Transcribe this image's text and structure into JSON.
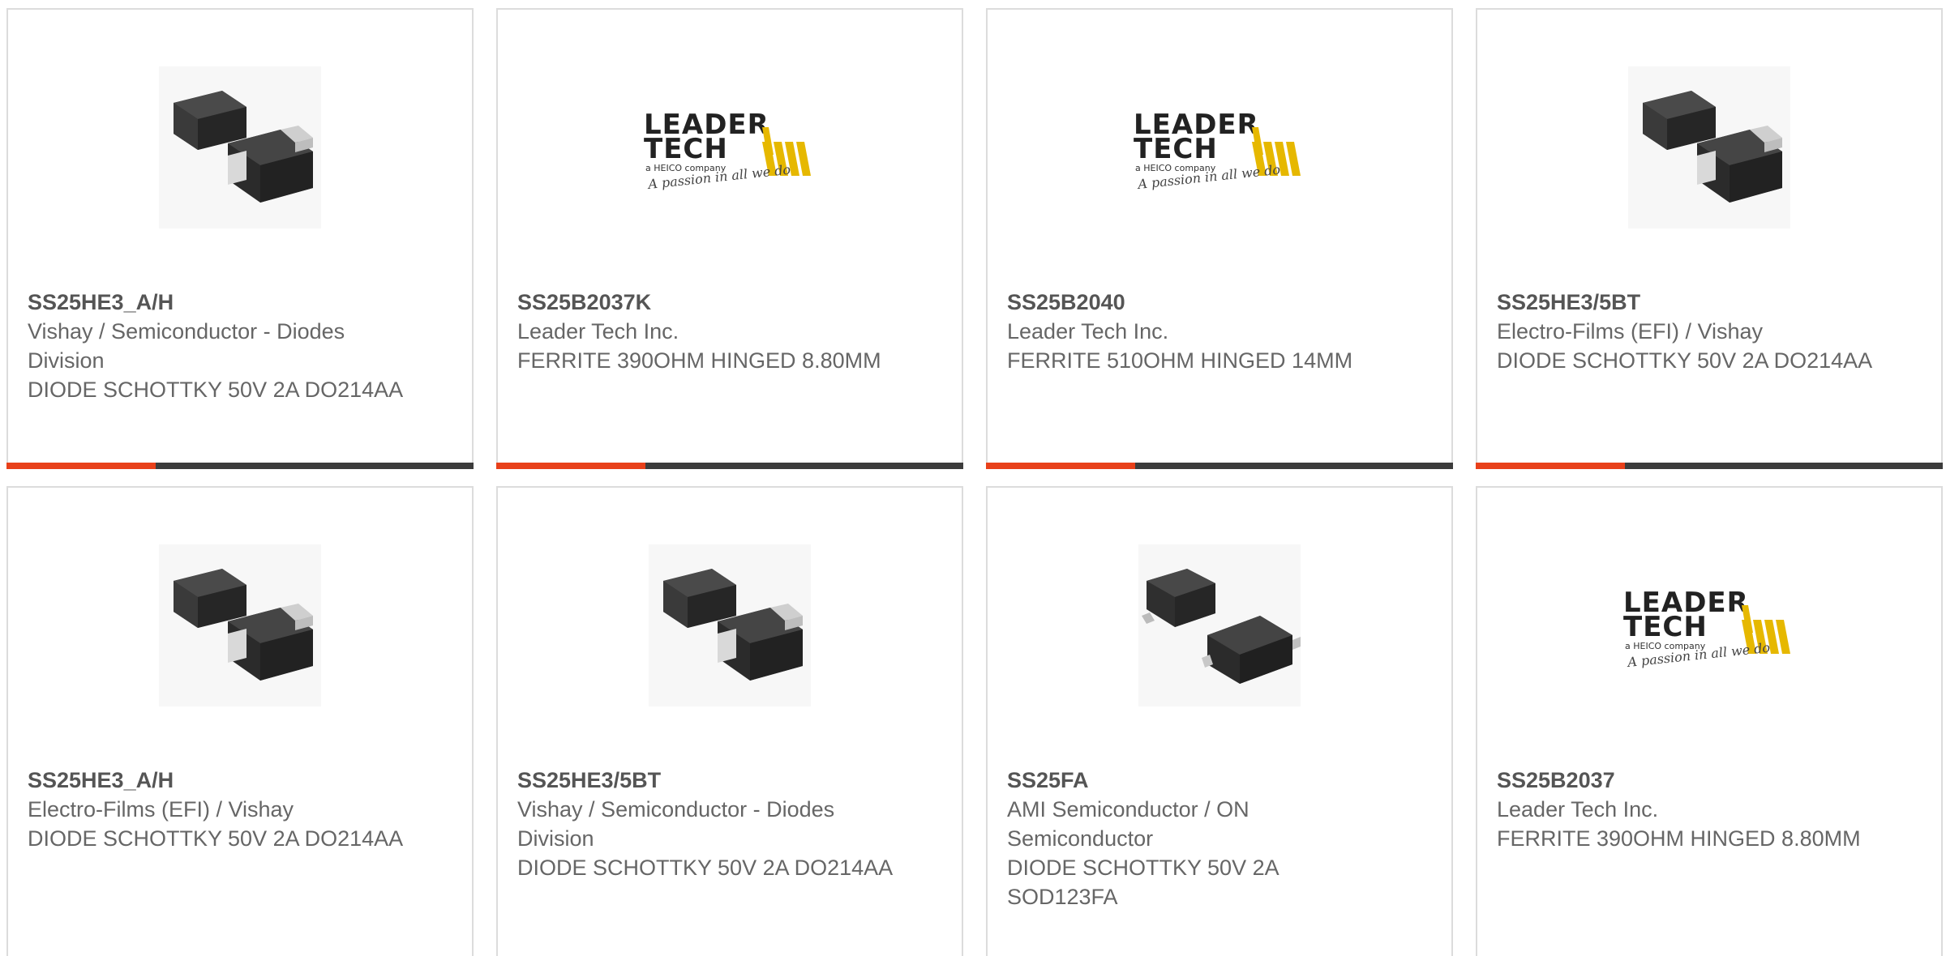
{
  "accent_color": "#e8401a",
  "bar_color": "#3c3c3c",
  "products": [
    {
      "part_number": "SS25HE3_A/H",
      "manufacturer": "Vishay / Semiconductor - Diodes Division",
      "description": "DIODE SCHOTTKY 50V 2A DO214AA",
      "image": "smd-diode-package-image"
    },
    {
      "part_number": "SS25B2037K",
      "manufacturer": "Leader Tech Inc.",
      "description": "FERRITE 390OHM HINGED 8.80MM",
      "image": "leader-tech-logo"
    },
    {
      "part_number": "SS25B2040",
      "manufacturer": "Leader Tech Inc.",
      "description": "FERRITE 510OHM HINGED 14MM",
      "image": "leader-tech-logo"
    },
    {
      "part_number": "SS25HE3/5BT",
      "manufacturer": "Electro-Films (EFI) / Vishay",
      "description": "DIODE SCHOTTKY 50V 2A DO214AA",
      "image": "smd-diode-package-image"
    },
    {
      "part_number": "SS25HE3_A/H",
      "manufacturer": "Electro-Films (EFI) / Vishay",
      "description": "DIODE SCHOTTKY 50V 2A DO214AA",
      "image": "smd-diode-package-image"
    },
    {
      "part_number": "SS25HE3/5BT",
      "manufacturer": "Vishay / Semiconductor - Diodes Division",
      "description": "DIODE SCHOTTKY 50V 2A DO214AA",
      "image": "smd-diode-package-image"
    },
    {
      "part_number": "SS25FA",
      "manufacturer": "AMI Semiconductor / ON Semiconductor",
      "description": "DIODE SCHOTTKY 50V 2A SOD123FA",
      "image": "sod123-package-image"
    },
    {
      "part_number": "SS25B2037",
      "manufacturer": "Leader Tech Inc.",
      "description": "FERRITE 390OHM HINGED 8.80MM",
      "image": "leader-tech-logo"
    }
  ],
  "logo": {
    "line1": "LEADER",
    "line2": "TECH",
    "tagline": "a HEICO company",
    "slogan": "A passion in all we do"
  }
}
